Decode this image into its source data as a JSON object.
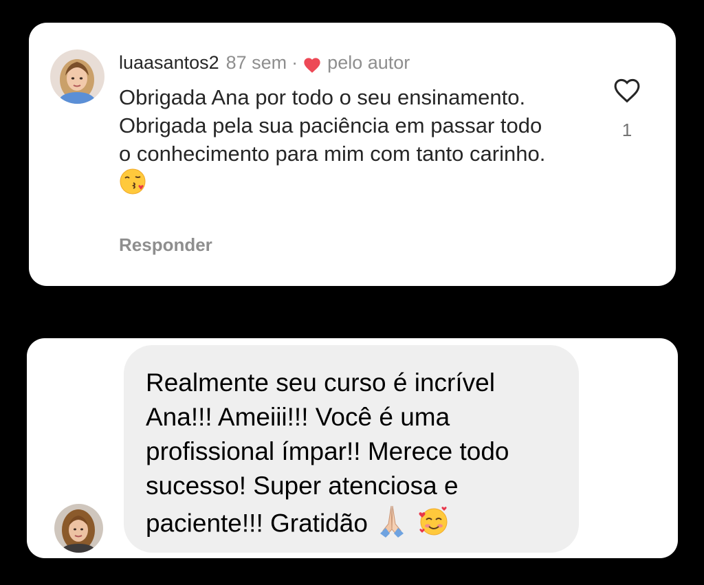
{
  "comment": {
    "username": "luaasantos2",
    "time": "87 sem",
    "separator": "·",
    "liked_by_author": "pelo autor",
    "text": "Obrigada Ana por todo o seu ensinamento. Obrigada pela sua paciência em passar todo o conhecimento para mim com tanto carinho.",
    "emoji": "face-blowing-kiss-emoji",
    "reply_label": "Responder",
    "like_count": "1",
    "like_icon": "heart-outline-icon",
    "author_heart_color": "#ed4956"
  },
  "message": {
    "text": "Realmente seu curso é incrível Ana!!! Ameiii!!! Você é uma profissional ímpar!! Merece todo sucesso! Super atenciosa e paciente!!! Gratidão",
    "emojis": [
      "folded-hands-emoji",
      "smiling-face-with-hearts-emoji"
    ],
    "bubble_color": "#efefef"
  }
}
